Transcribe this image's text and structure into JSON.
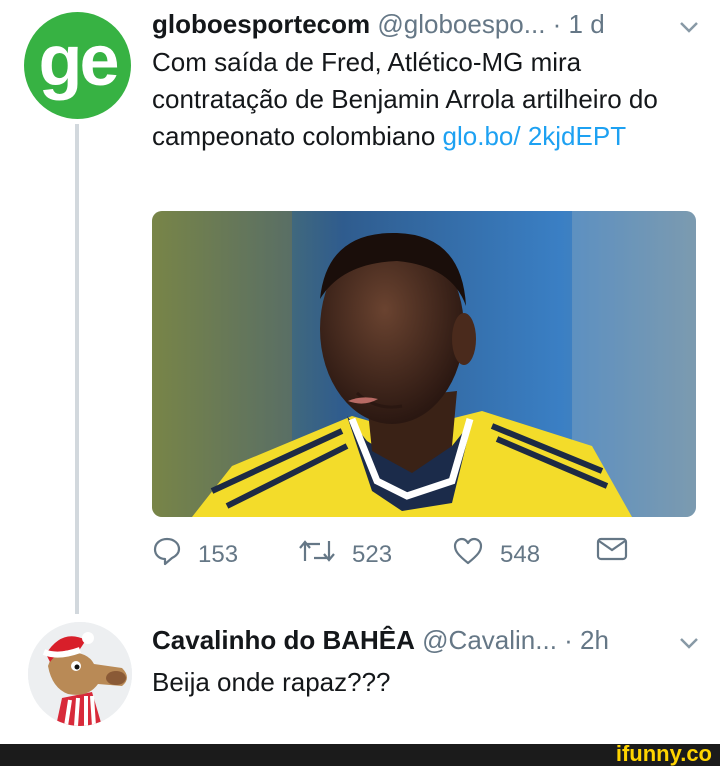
{
  "tweet1": {
    "avatar_text": "ge",
    "name": "globoesportecom",
    "handle": "@globoespo...",
    "time": "· 1 d",
    "text_before_link": "Com saída de Fred, Atlético-MG mira contratação de Benjamin Arrola artilheiro do campeonato colombiano ",
    "link": "glo.bo/ 2kjdEPT",
    "replies": "153",
    "retweets": "523",
    "likes": "548"
  },
  "tweet2": {
    "name": "Cavalinho do BAHÊA",
    "handle": "@Cavalin...",
    "time": "· 2h",
    "text": "Beija onde rapaz???"
  },
  "watermark": "ifunny.co",
  "colors": {
    "link": "#1da1f2",
    "muted": "#657786",
    "ge_green": "#37b243",
    "jersey_yellow": "#f3dc2a"
  },
  "icons": [
    "chevron-down-icon",
    "reply-icon",
    "retweet-icon",
    "like-icon",
    "dm-icon"
  ]
}
